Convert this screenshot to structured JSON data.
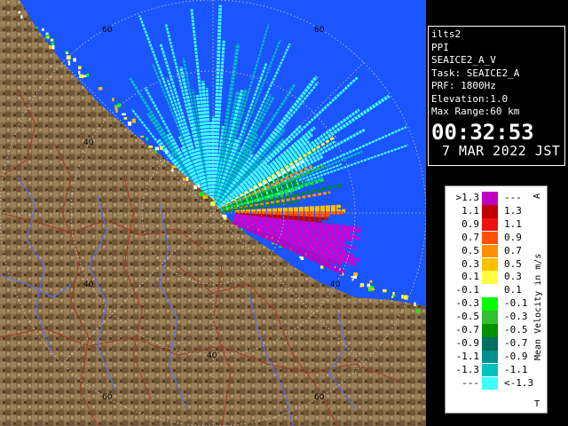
{
  "info": {
    "station": "ilts2",
    "mode": "PPI",
    "product": "SEAICE2_A_V",
    "task": "Task: SEAICE2_A",
    "prf": "PRF: 1800Hz",
    "elevation": "Elevation:1.0",
    "max_range": "Max Range:60 km",
    "time": "00:32:53",
    "date": "7 MAR 2022 JST"
  },
  "ring_labels": {
    "top_left": "60",
    "top_right": "60",
    "mid_left": "40",
    "mid_right": "40",
    "bottom_center": "40",
    "bottom_left": "60",
    "bottom_right": "60",
    "left_40": "40"
  },
  "legend": {
    "title": "Mean Velocity in m/s",
    "top_marker": "A",
    "bottom_marker": "T",
    "rows": [
      {
        "left": ">1.3",
        "right": "---",
        "color": "#c000c0"
      },
      {
        "left": "1.1",
        "right": "1.3",
        "color": "#c00000"
      },
      {
        "left": "0.9",
        "right": "1.1",
        "color": "#f01010"
      },
      {
        "left": "0.7",
        "right": "0.9",
        "color": "#ff5000"
      },
      {
        "left": "0.5",
        "right": "0.7",
        "color": "#ff9000"
      },
      {
        "left": "0.3",
        "right": "0.5",
        "color": "#ffc000"
      },
      {
        "left": "0.1",
        "right": "0.3",
        "color": "#ffff40"
      },
      {
        "left": "-0.1",
        "right": "0.1",
        "color": "#ffffff"
      },
      {
        "left": "-0.3",
        "right": "-0.1",
        "color": "#00ff00"
      },
      {
        "left": "-0.5",
        "right": "-0.3",
        "color": "#30c030"
      },
      {
        "left": "-0.7",
        "right": "-0.5",
        "color": "#009000"
      },
      {
        "left": "-0.9",
        "right": "-0.7",
        "color": "#007060"
      },
      {
        "left": "-1.1",
        "right": "-0.9",
        "color": "#009090"
      },
      {
        "left": "-1.3",
        "right": "-1.1",
        "color": "#00c0c0"
      },
      {
        "left": "---",
        "right": "<-1.3",
        "color": "#40ffff"
      }
    ]
  },
  "colors": {
    "sea": "#1a55ff",
    "land": "#8a6e48",
    "cyan": "#40ffff",
    "magenta": "#d000d0"
  }
}
